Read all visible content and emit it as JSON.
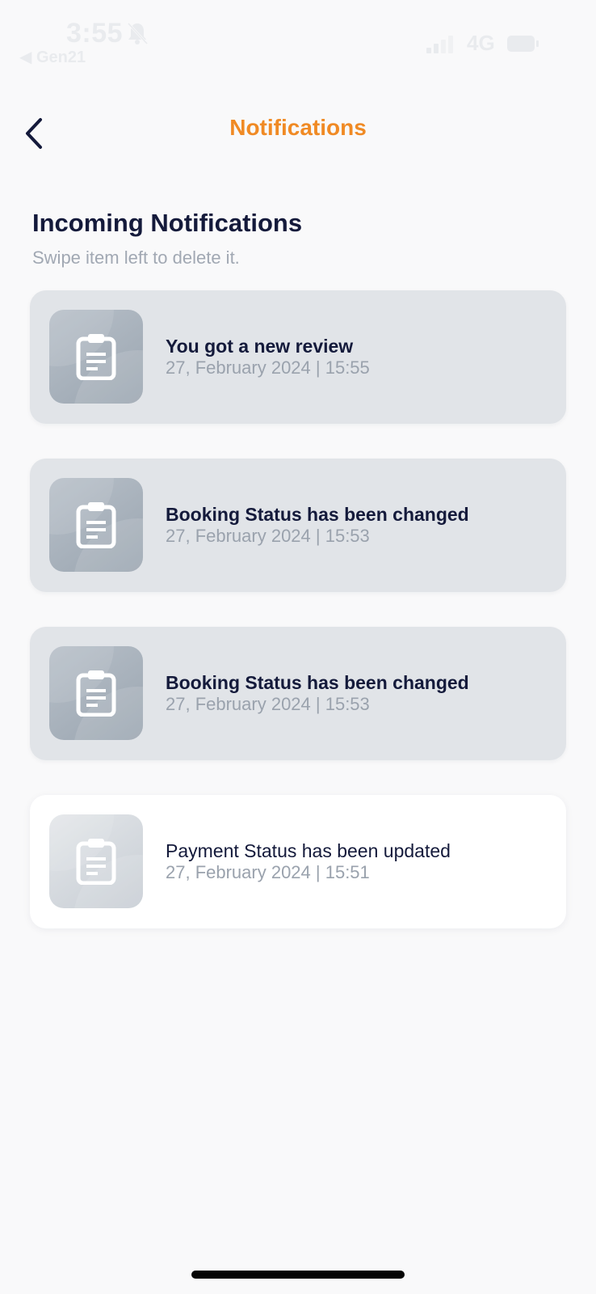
{
  "status_bar": {
    "time": "3:55",
    "back_app": "◀ Gen21",
    "network": "4G"
  },
  "header": {
    "title": "Notifications"
  },
  "section": {
    "title": "Incoming Notifications",
    "hint": "Swipe item left to delete it."
  },
  "notifications": [
    {
      "title": "You got a new review",
      "time": "27, February 2024 | 15:55",
      "read": false
    },
    {
      "title": "Booking Status has been changed",
      "time": "27, February 2024 | 15:53",
      "read": false
    },
    {
      "title": "Booking Status has been changed",
      "time": "27, February 2024 | 15:53",
      "read": false
    },
    {
      "title": "Payment Status has been updated",
      "time": "27, February 2024 | 15:51",
      "read": true
    }
  ],
  "colors": {
    "accent": "#f08a24",
    "heading": "#141a3b",
    "unread_card": "#e1e4e8",
    "read_card": "#ffffff"
  },
  "icons": {
    "back": "chevron-left-icon",
    "notification": "clipboard-icon"
  }
}
